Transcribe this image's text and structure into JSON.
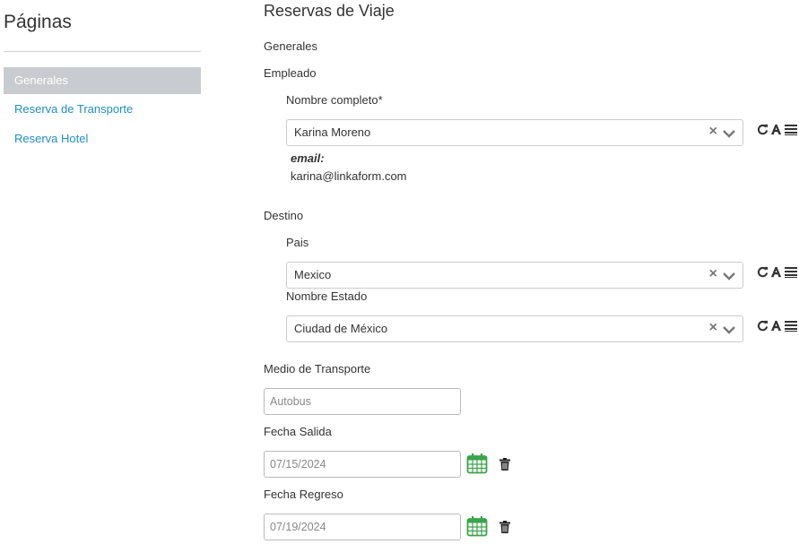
{
  "sidebar": {
    "title": "Páginas",
    "items": [
      {
        "label": "Generales",
        "active": true
      },
      {
        "label": "Reserva de Transporte",
        "active": false
      },
      {
        "label": "Reserva Hotel",
        "active": false
      }
    ]
  },
  "form": {
    "title": "Reservas de Viaje",
    "section_general": "Generales",
    "group_employee": "Empleado",
    "full_name_label": "Nombre completo*",
    "full_name_value": "Karina Moreno",
    "email_label": "email:",
    "email_value": "karina@linkaform.com",
    "group_destination": "Destino",
    "country_label": "Pais",
    "country_value": "Mexico",
    "state_label": "Nombre Estado",
    "state_value": "Ciudad de México",
    "transport_label": "Medio de Transporte",
    "transport_placeholder": "Autobus",
    "departure_label": "Fecha Salida",
    "departure_value": "07/15/2024",
    "return_label": "Fecha Regreso",
    "return_value": "07/19/2024",
    "clear_glyph": "×"
  },
  "icons": {
    "tool_refresh": "refresh-icon",
    "tool_font": "font-icon",
    "tool_list": "list-icon",
    "calendar": "calendar-icon",
    "trash": "trash-icon"
  },
  "colors": {
    "link": "#1f8fc6",
    "active_nav_bg": "#c8ccd0",
    "calendar_green": "#3aa54a"
  }
}
